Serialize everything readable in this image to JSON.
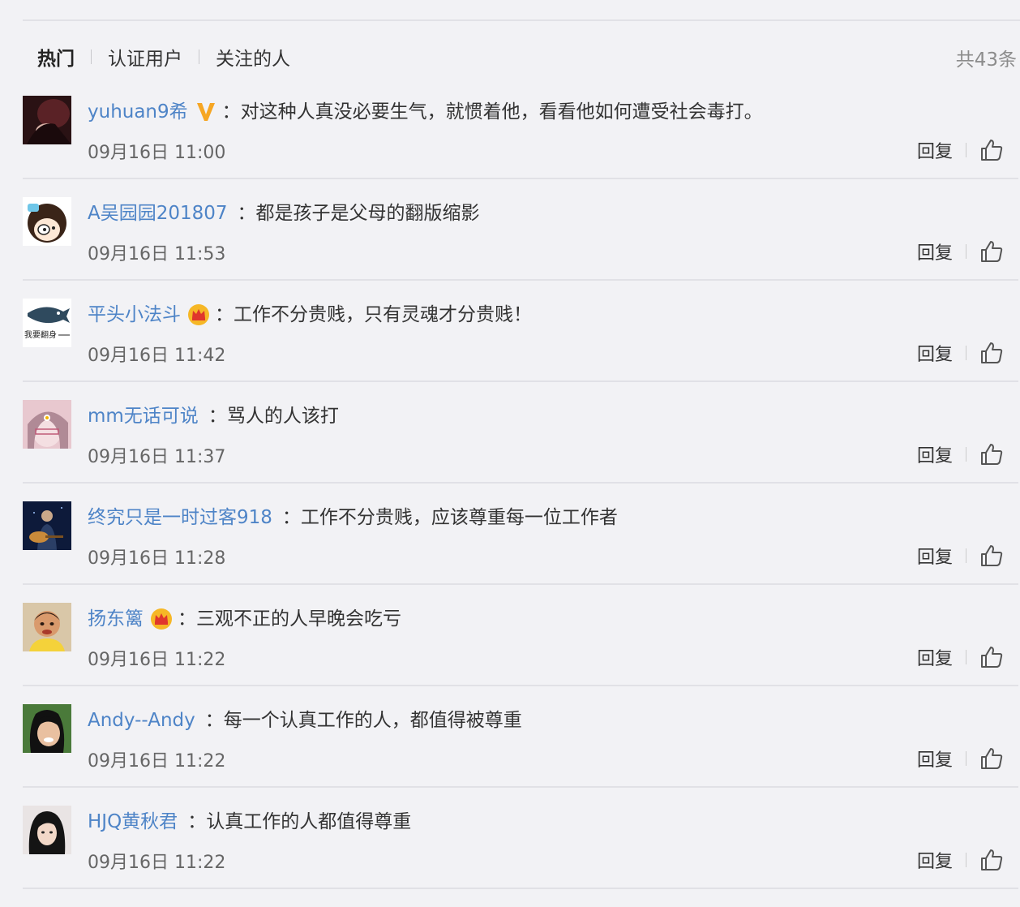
{
  "tabs": [
    {
      "label": "热门",
      "active": true
    },
    {
      "label": "认证用户",
      "active": false
    },
    {
      "label": "关注的人",
      "active": false
    }
  ],
  "total_count": "共43条",
  "colors": {
    "username": "#4e84c7",
    "background": "#f2f2f5",
    "divider": "#e1e1e6",
    "verified_badge": "#f6a623",
    "crown_badge": "#f6a623"
  },
  "comments": [
    {
      "username": "yuhuan9希",
      "badge": "verified-v-icon",
      "colon": "：",
      "content": "对这种人真没必要生气，就惯着他，看看他如何遭受社会毒打。",
      "time": "09月16日 11:00",
      "reply": "回复"
    },
    {
      "username": "A吴园园201807",
      "badge": "",
      "colon": "：",
      "content": "都是孩子是父母的翻版缩影",
      "time": "09月16日 11:53",
      "reply": "回复"
    },
    {
      "username": "平头小法斗",
      "badge": "crown-icon",
      "colon": "：",
      "content": "工作不分贵贱，只有灵魂才分贵贱！",
      "time": "09月16日 11:42",
      "reply": "回复",
      "avatar_text": "我要翻身"
    },
    {
      "username": "mm无话可说",
      "badge": "",
      "colon": "：",
      "content": "骂人的人该打",
      "time": "09月16日 11:37",
      "reply": "回复"
    },
    {
      "username": "终究只是一时过客918",
      "badge": "",
      "colon": "：",
      "content": "工作不分贵贱，应该尊重每一位工作者",
      "time": "09月16日 11:28",
      "reply": "回复"
    },
    {
      "username": "扬东篱",
      "badge": "crown-icon",
      "colon": "：",
      "content": "三观不正的人早晚会吃亏",
      "time": "09月16日 11:22",
      "reply": "回复"
    },
    {
      "username": "Andy--Andy",
      "badge": "",
      "colon": "：",
      "content": "每一个认真工作的人，都值得被尊重",
      "time": "09月16日 11:22",
      "reply": "回复"
    },
    {
      "username": "HJQ黄秋君",
      "badge": "",
      "colon": "：",
      "content": "认真工作的人都值得尊重",
      "time": "09月16日 11:22",
      "reply": "回复"
    }
  ]
}
